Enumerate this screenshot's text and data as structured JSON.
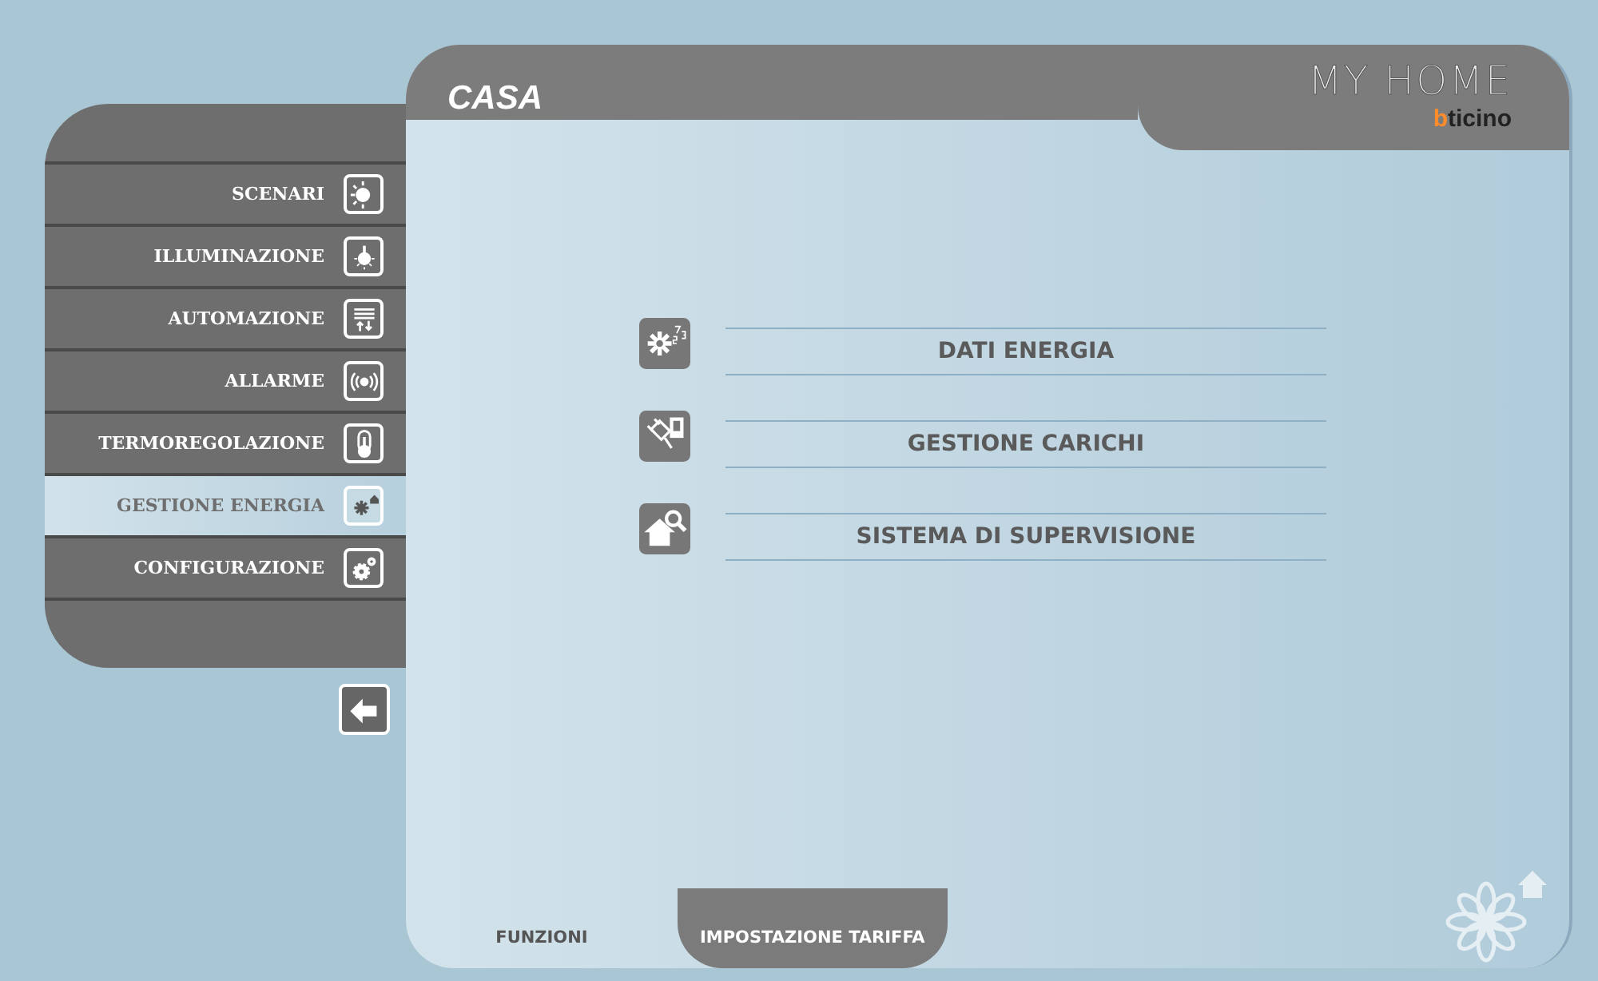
{
  "header": {
    "title": "CASA",
    "logo_title": "MY HOME",
    "logo_brand": "bticino"
  },
  "sidebar": {
    "items": [
      {
        "label": "SCENARI",
        "selected": false
      },
      {
        "label": "ILLUMINAZIONE",
        "selected": false
      },
      {
        "label": "AUTOMAZIONE",
        "selected": false
      },
      {
        "label": "ALLARME",
        "selected": false
      },
      {
        "label": "TERMOREGOLAZIONE",
        "selected": false
      },
      {
        "label": "GESTIONE ENERGIA",
        "selected": true
      },
      {
        "label": "CONFIGURAZIONE",
        "selected": false
      }
    ]
  },
  "menu": [
    {
      "label": "DATI ENERGIA"
    },
    {
      "label": "GESTIONE CARICHI"
    },
    {
      "label": "SISTEMA DI SUPERVISIONE"
    }
  ],
  "tabs": [
    {
      "label": "FUNZIONI",
      "selected": true
    },
    {
      "label": "IMPOSTAZIONE TARIFFA",
      "selected": false
    }
  ]
}
